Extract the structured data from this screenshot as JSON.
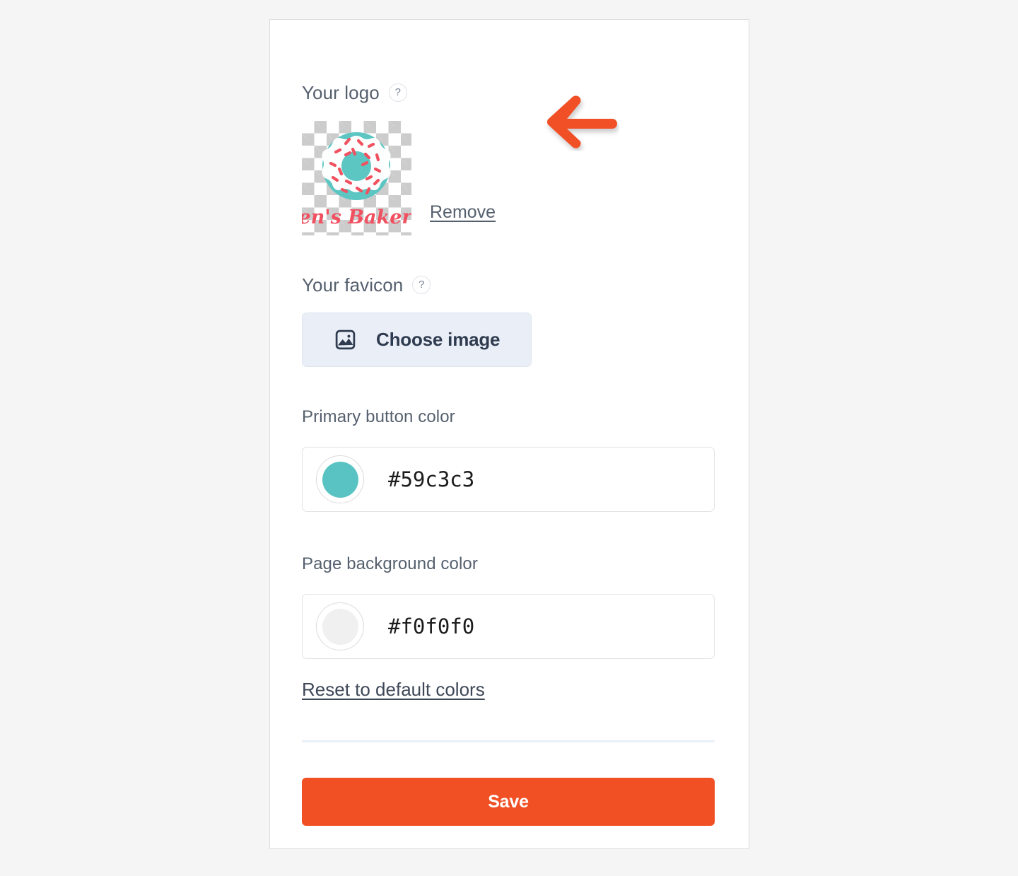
{
  "page": {
    "background_color": "#f5f5f5",
    "card_background": "#ffffff"
  },
  "logo_section": {
    "label": "Your logo",
    "help_icon": "question-mark-icon",
    "help_badge_text": "?",
    "preview_alt": "Jen's Bakery donut logo on transparent checkerboard",
    "brand_text": "Jen's Bakery",
    "donut_color": "#5cc6c3",
    "icing_color": "#ffffff",
    "sprinkle_color": "#f0515f",
    "brand_text_color": "#f05060",
    "remove_label": "Remove"
  },
  "annotation": {
    "arrow_icon": "left-arrow-icon",
    "arrow_color": "#f15025",
    "points_at": "Remove"
  },
  "favicon_section": {
    "label": "Your favicon",
    "help_badge_text": "?",
    "choose_image_label": "Choose image",
    "choose_image_icon": "image-icon",
    "button_background": "#eaeff7"
  },
  "colors_section": {
    "primary_button_color": {
      "label": "Primary button color",
      "value": "#59c3c3",
      "swatch_icon": "color-swatch-icon"
    },
    "page_background_color": {
      "label": "Page background color",
      "value": "#f0f0f0",
      "swatch_icon": "color-swatch-icon"
    },
    "reset_label": "Reset to default colors"
  },
  "footer": {
    "save_label": "Save",
    "save_color": "#f15025"
  }
}
